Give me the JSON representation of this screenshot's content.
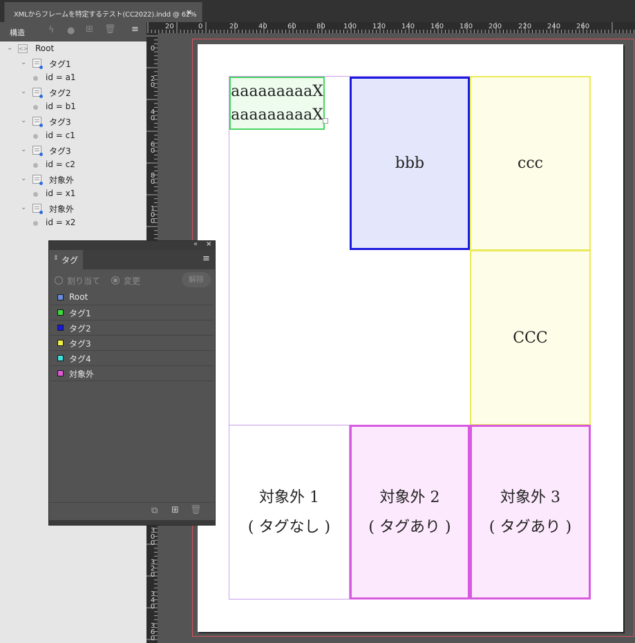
{
  "document_tab": {
    "title": "XMLからフレームを特定するテスト(CC2022).indd @ 62%",
    "close": "×"
  },
  "structure_panel": {
    "title": "構造",
    "tree": [
      {
        "label": "Root"
      },
      {
        "label": "タグ1",
        "attr": "id = a1"
      },
      {
        "label": "タグ2",
        "attr": "id = b1"
      },
      {
        "label": "タグ3",
        "attr": "id = c1"
      },
      {
        "label": "タグ3",
        "attr": "id = c2"
      },
      {
        "label": "対象外",
        "attr": "id = x1"
      },
      {
        "label": "対象外",
        "attr": "id = x2"
      }
    ]
  },
  "ruler_top": [
    "20",
    "0",
    "20",
    "40",
    "60",
    "80",
    "100",
    "120",
    "140",
    "160",
    "180",
    "200",
    "220",
    "240",
    "260"
  ],
  "ruler_left": [
    "0",
    "20",
    "40",
    "60",
    "80",
    "100",
    "300",
    "320",
    "340",
    "360"
  ],
  "tag_panel": {
    "tab_label": "タグ",
    "radio_assign": "割り当て",
    "radio_change": "変更",
    "remove_button": "解除",
    "tags": [
      {
        "name": "Root",
        "color": "#6b8de0"
      },
      {
        "name": "タグ1",
        "color": "#3ddc3d"
      },
      {
        "name": "タグ2",
        "color": "#1a1ad6"
      },
      {
        "name": "タグ3",
        "color": "#f0f048"
      },
      {
        "name": "タグ4",
        "color": "#3ee0e0"
      },
      {
        "name": "対象外",
        "color": "#e05ad6"
      }
    ]
  },
  "page": {
    "frame_a_line1": "aaaaaaaaaX",
    "frame_a_line2": "aaaaaaaaaX",
    "frame_b": "bbb",
    "frame_c1": "ccc",
    "frame_c2": "CCC",
    "frame_x1_line1": "対象外 1",
    "frame_x1_line2": "( タグなし )",
    "frame_x2_line1": "対象外 2",
    "frame_x2_line2": "( タグあり )",
    "frame_x3_line1": "対象外 3",
    "frame_x3_line2": "( タグあり )"
  }
}
